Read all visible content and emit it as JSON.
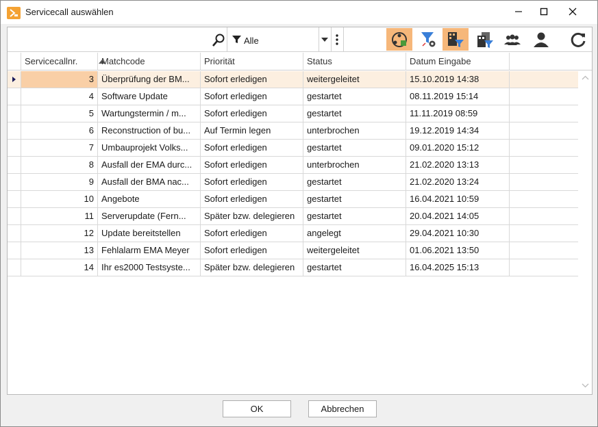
{
  "window": {
    "title": "Servicecall auswählen",
    "accent": "#f4a233"
  },
  "toolbar": {
    "filter_value": "Alle",
    "icons": [
      "search-icon",
      "funnel-icon",
      "chevron-down-icon",
      "more-vertical-icon",
      "org-chart-icon",
      "filter-settings-icon",
      "building-filter-icon",
      "buildings-filter-icon",
      "group-icon",
      "user-icon",
      "refresh-icon"
    ]
  },
  "columns": [
    "Servicecallnr.",
    "Matchcode",
    "Priorität",
    "Status",
    "Datum Eingabe"
  ],
  "rows": [
    {
      "nr": "3",
      "matchcode": "Überprüfung der BM...",
      "prioritaet": "Sofort erledigen",
      "status": "weitergeleitet",
      "datum": "15.10.2019 14:38"
    },
    {
      "nr": "4",
      "matchcode": "Software Update",
      "prioritaet": "Sofort erledigen",
      "status": "gestartet",
      "datum": "08.11.2019 15:14"
    },
    {
      "nr": "5",
      "matchcode": "Wartungstermin / m...",
      "prioritaet": "Sofort erledigen",
      "status": "gestartet",
      "datum": "11.11.2019 08:59"
    },
    {
      "nr": "6",
      "matchcode": "Reconstruction of bu...",
      "prioritaet": "Auf Termin legen",
      "status": "unterbrochen",
      "datum": "19.12.2019 14:34"
    },
    {
      "nr": "7",
      "matchcode": "Umbauprojekt Volks...",
      "prioritaet": "Sofort erledigen",
      "status": "gestartet",
      "datum": "09.01.2020 15:12"
    },
    {
      "nr": "8",
      "matchcode": "Ausfall der EMA durc...",
      "prioritaet": "Sofort erledigen",
      "status": "unterbrochen",
      "datum": "21.02.2020 13:13"
    },
    {
      "nr": "9",
      "matchcode": "Ausfall der BMA nac...",
      "prioritaet": "Sofort erledigen",
      "status": "gestartet",
      "datum": "21.02.2020 13:24"
    },
    {
      "nr": "10",
      "matchcode": "Angebote",
      "prioritaet": "Sofort erledigen",
      "status": "gestartet",
      "datum": "16.04.2021 10:59"
    },
    {
      "nr": "11",
      "matchcode": "Serverupdate (Fern...",
      "prioritaet": "Später bzw. delegieren",
      "status": "gestartet",
      "datum": "20.04.2021 14:05"
    },
    {
      "nr": "12",
      "matchcode": "Update bereitstellen",
      "prioritaet": "Sofort erledigen",
      "status": "angelegt",
      "datum": "29.04.2021 10:30"
    },
    {
      "nr": "13",
      "matchcode": "Fehlalarm EMA Meyer",
      "prioritaet": "Sofort erledigen",
      "status": "weitergeleitet",
      "datum": "01.06.2021 13:50"
    },
    {
      "nr": "14",
      "matchcode": "Ihr es2000 Testsyste...",
      "prioritaet": "Später bzw. delegieren",
      "status": "gestartet",
      "datum": "16.04.2025 15:13"
    }
  ],
  "buttons": {
    "ok": "OK",
    "cancel": "Abbrechen"
  }
}
